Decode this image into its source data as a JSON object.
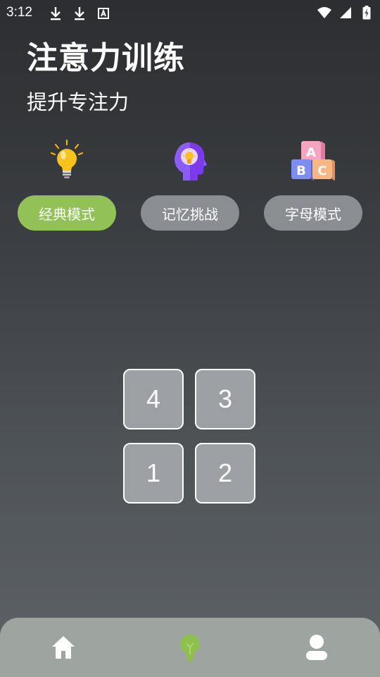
{
  "status_bar": {
    "time": "3:12"
  },
  "header": {
    "title": "注意力训练",
    "subtitle": "提升专注力"
  },
  "modes": [
    {
      "label": "经典模式",
      "icon": "lightbulb-icon",
      "active": true
    },
    {
      "label": "记忆挑战",
      "icon": "brain-lightbulb-icon",
      "active": false
    },
    {
      "label": "字母模式",
      "icon": "abc-blocks-icon",
      "active": false
    }
  ],
  "grid": {
    "cells": [
      "4",
      "3",
      "1",
      "2"
    ]
  },
  "bottom_nav": {
    "items": [
      "home-icon",
      "lightbulb-icon",
      "profile-icon"
    ],
    "active_index": 1
  },
  "colors": {
    "active_mode": "#92c257",
    "inactive_mode": "#8a8d91",
    "nav_bg": "#9ea5a0",
    "active_nav_icon": "#8fc04f"
  }
}
